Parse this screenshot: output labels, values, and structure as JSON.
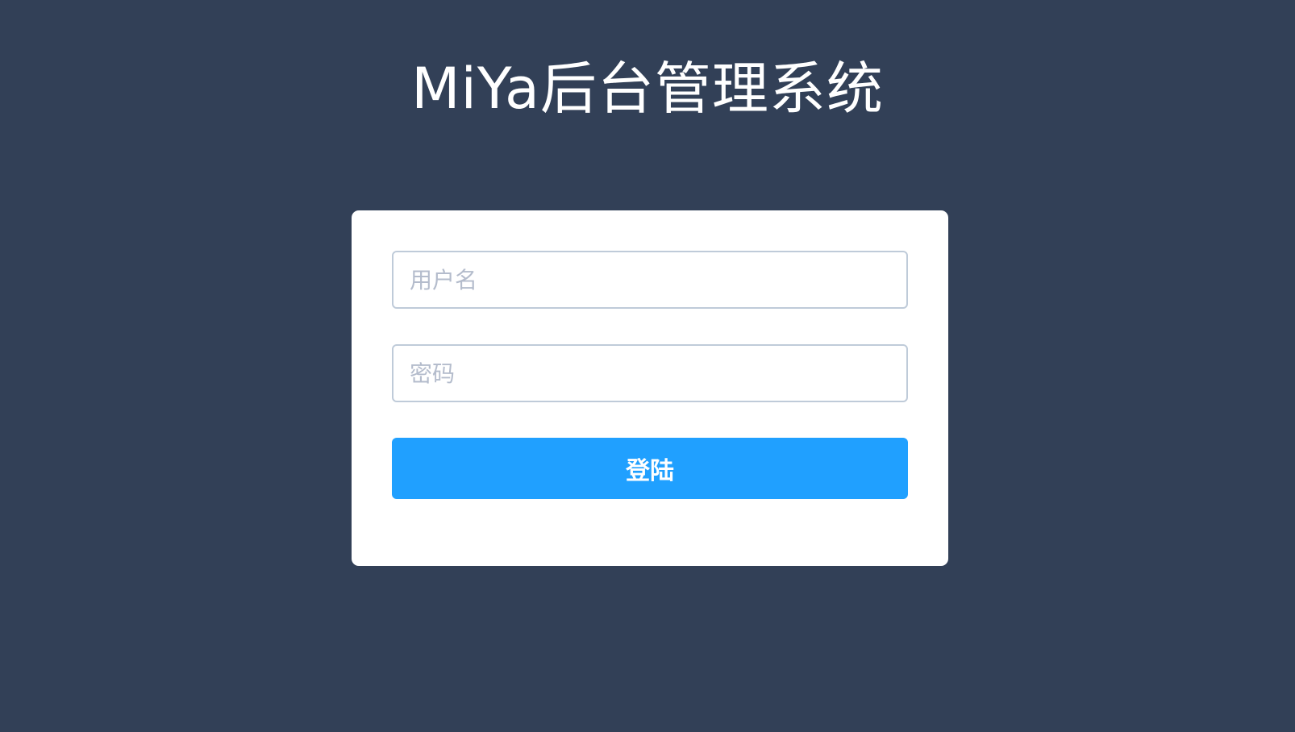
{
  "header": {
    "title": "MiYa后台管理系统"
  },
  "login_form": {
    "username": {
      "placeholder": "用户名",
      "value": ""
    },
    "password": {
      "placeholder": "密码",
      "value": ""
    },
    "submit_label": "登陆"
  },
  "colors": {
    "background": "#324057",
    "card": "#ffffff",
    "input_border": "#bfcbd9",
    "placeholder": "#b4bccc",
    "primary_button": "#20a0ff"
  }
}
